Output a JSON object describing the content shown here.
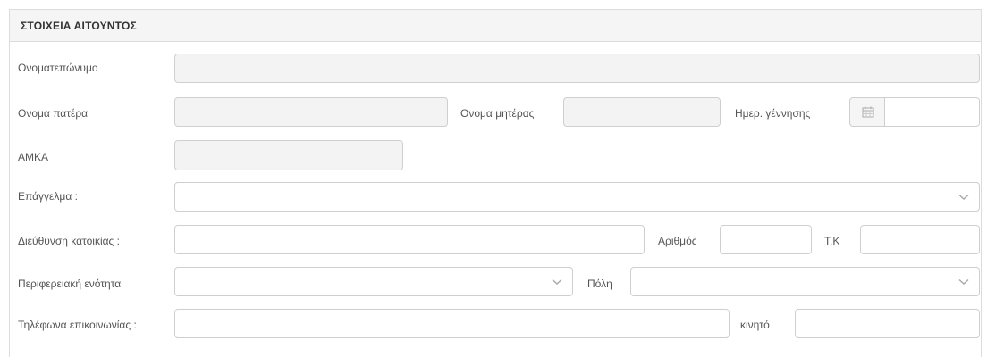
{
  "section": {
    "title": "ΣΤΟΙΧΕΙΑ ΑΙΤΟΥΝΤΟΣ"
  },
  "fields": {
    "full_name": {
      "label": "Ονοματεπώνυμο",
      "value": ""
    },
    "father_name": {
      "label": "Ονομα πατέρα",
      "value": ""
    },
    "mother_name": {
      "label": "Ονομα μητέρας",
      "value": ""
    },
    "birth_date": {
      "label": "Ημερ. γέννησης",
      "value": ""
    },
    "amka": {
      "label": "ΑΜΚΑ",
      "value": ""
    },
    "profession": {
      "label": "Επάγγελμα :",
      "value": ""
    },
    "address": {
      "label": "Διεύθυνση κατοικίας :",
      "value": ""
    },
    "number": {
      "label": "Αριθμός",
      "value": ""
    },
    "postal_code": {
      "label": "Τ.Κ",
      "value": ""
    },
    "region": {
      "label": "Περιφερειακή ενότητα",
      "value": ""
    },
    "city": {
      "label": "Πόλη",
      "value": ""
    },
    "phones": {
      "label": "Τηλέφωνα επικοινωνίας :",
      "value": ""
    },
    "mobile": {
      "label": "κινητό",
      "value": ""
    }
  },
  "icons": {
    "calendar": "calendar-icon",
    "dropdown": "chevron-down-icon"
  },
  "colors": {
    "border": "#cfcfcf",
    "readonly_bg": "#f3f3f3",
    "header_bg": "#f5f5f5"
  }
}
